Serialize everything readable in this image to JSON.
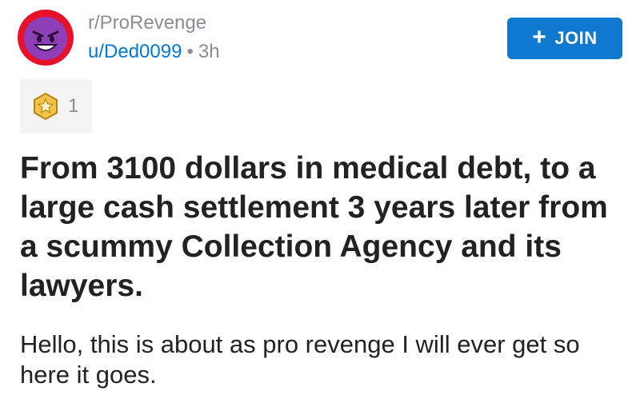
{
  "header": {
    "subreddit": "r/ProRevenge",
    "username": "u/Ded0099",
    "separator": "•",
    "age": "3h",
    "avatar_icon": "devil-face-icon",
    "join_label": "JOIN",
    "join_icon": "plus-icon"
  },
  "award": {
    "icon": "star-award-icon",
    "count": "1"
  },
  "post": {
    "title": "From 3100 dollars in medical debt, to a large cash settlement 3 years later from a scummy Collection Agency and its lawyers.",
    "body": "Hello, this is about as pro revenge I will ever get so here it goes."
  },
  "colors": {
    "accent": "#0079d3",
    "join_button": "#0f79d0",
    "avatar_ring": "#e8112a",
    "avatar_face": "#8e3fb8",
    "muted_text": "#8a8d91",
    "title_text": "#222222",
    "award_bg": "#f3f3f3"
  }
}
